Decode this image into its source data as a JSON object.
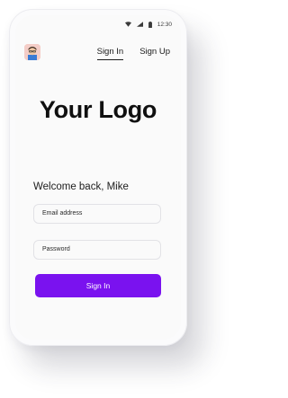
{
  "status_bar": {
    "time": "12:30",
    "icons": [
      "wifi-icon",
      "signal-icon",
      "battery-icon"
    ]
  },
  "header": {
    "avatar": "user-avatar",
    "tabs": [
      {
        "label": "Sign In",
        "active": true
      },
      {
        "label": "Sign Up",
        "active": false
      }
    ]
  },
  "logo": {
    "text": "Your Logo"
  },
  "welcome": {
    "text": "Welcome back, Mike"
  },
  "form": {
    "email_label": "Email address",
    "password_label": "Password",
    "submit_label": "Sign In"
  },
  "colors": {
    "primary": "#7a12ef",
    "text": "#1a1a1a",
    "background": "#fafafa"
  }
}
